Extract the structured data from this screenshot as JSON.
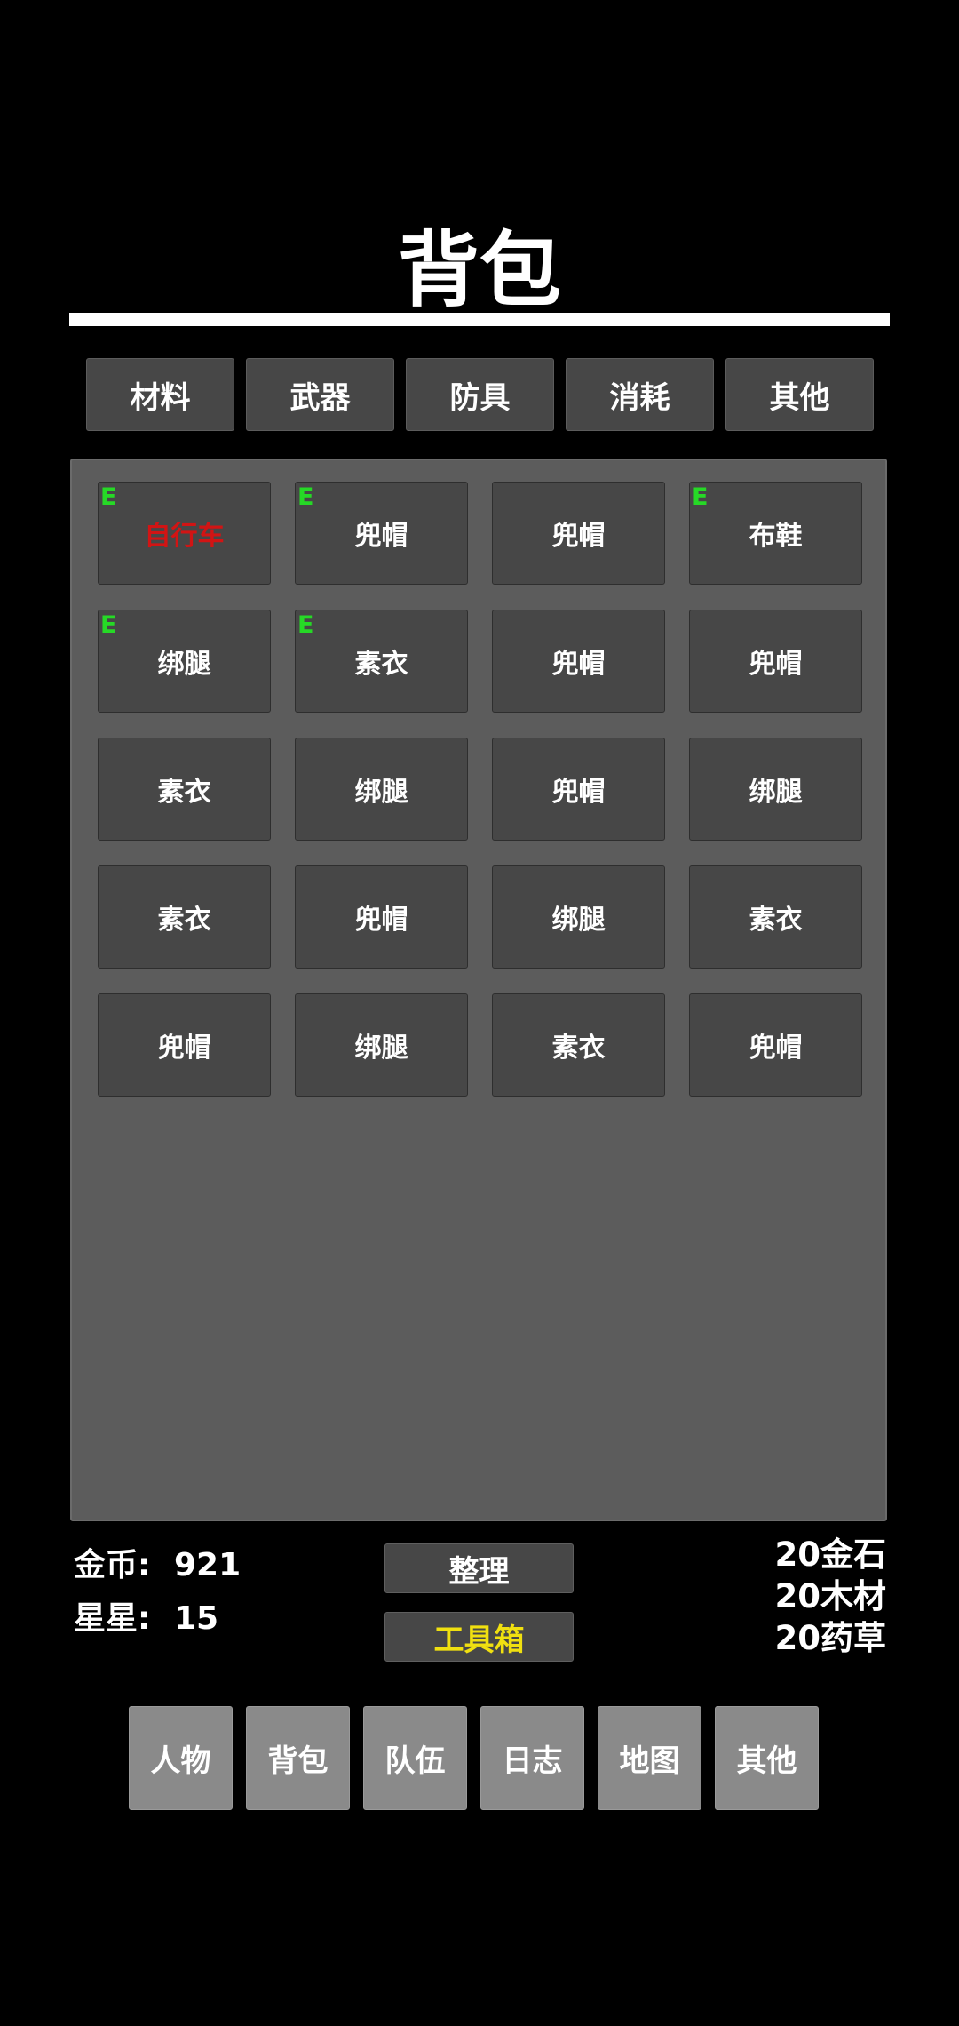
{
  "title": "背包",
  "tabs": [
    "材料",
    "武器",
    "防具",
    "消耗",
    "其他"
  ],
  "equip_marker": "E",
  "colors": {
    "equip_marker": "#26d926",
    "rare_item": "#d21414",
    "toolbox_label": "#f0e010"
  },
  "inventory": [
    {
      "name": "自行车",
      "equipped": true,
      "rare": true
    },
    {
      "name": "兜帽",
      "equipped": true,
      "rare": false
    },
    {
      "name": "兜帽",
      "equipped": false,
      "rare": false
    },
    {
      "name": "布鞋",
      "equipped": true,
      "rare": false
    },
    {
      "name": "绑腿",
      "equipped": true,
      "rare": false
    },
    {
      "name": "素衣",
      "equipped": true,
      "rare": false
    },
    {
      "name": "兜帽",
      "equipped": false,
      "rare": false
    },
    {
      "name": "兜帽",
      "equipped": false,
      "rare": false
    },
    {
      "name": "素衣",
      "equipped": false,
      "rare": false
    },
    {
      "name": "绑腿",
      "equipped": false,
      "rare": false
    },
    {
      "name": "兜帽",
      "equipped": false,
      "rare": false
    },
    {
      "name": "绑腿",
      "equipped": false,
      "rare": false
    },
    {
      "name": "素衣",
      "equipped": false,
      "rare": false
    },
    {
      "name": "兜帽",
      "equipped": false,
      "rare": false
    },
    {
      "name": "绑腿",
      "equipped": false,
      "rare": false
    },
    {
      "name": "素衣",
      "equipped": false,
      "rare": false
    },
    {
      "name": "兜帽",
      "equipped": false,
      "rare": false
    },
    {
      "name": "绑腿",
      "equipped": false,
      "rare": false
    },
    {
      "name": "素衣",
      "equipped": false,
      "rare": false
    },
    {
      "name": "兜帽",
      "equipped": false,
      "rare": false
    }
  ],
  "stats": {
    "gold_label": "金币:",
    "gold_value": "921",
    "stars_label": "星星:",
    "stars_value": "15"
  },
  "actions": {
    "sort_label": "整理",
    "toolbox_label": "工具箱"
  },
  "resources": [
    "20金石",
    "20木材",
    "20药草"
  ],
  "nav": [
    "人物",
    "背包",
    "队伍",
    "日志",
    "地图",
    "其他"
  ]
}
